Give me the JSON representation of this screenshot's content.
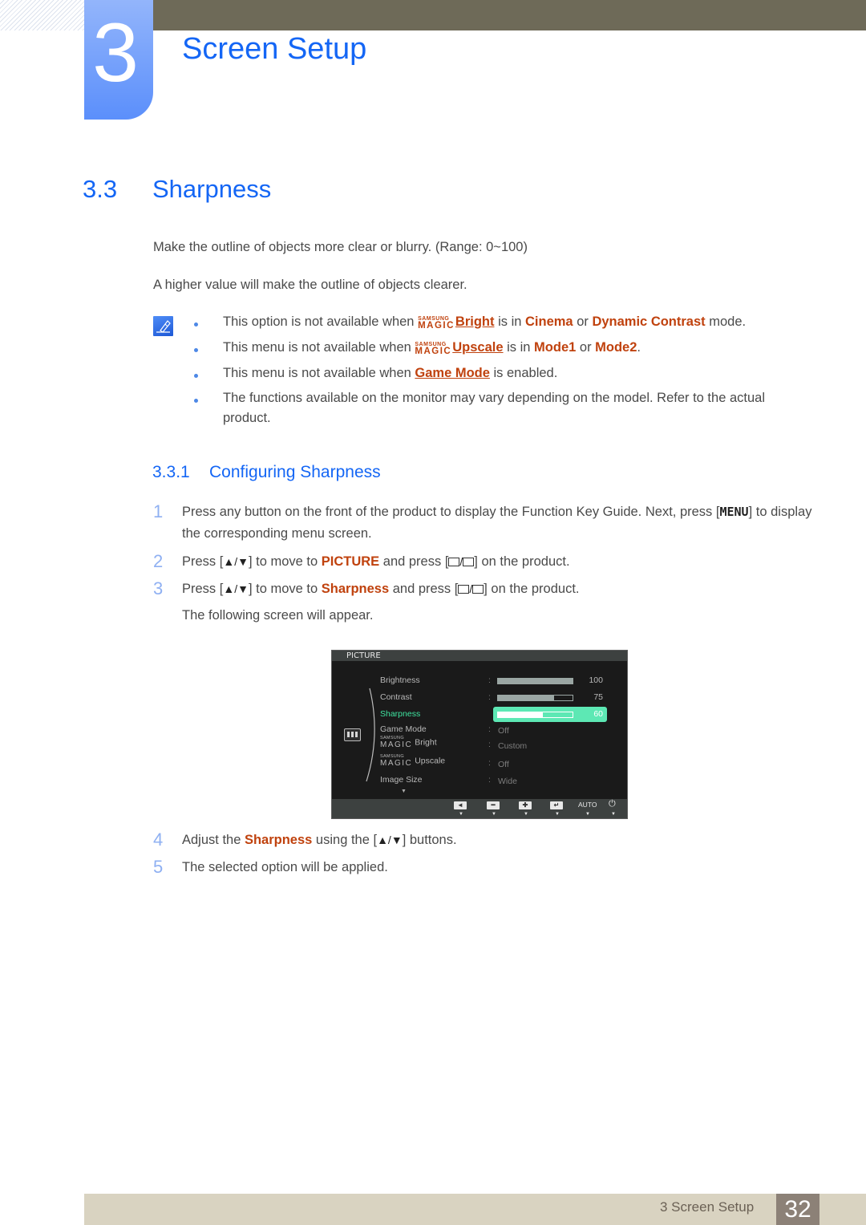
{
  "chapter": {
    "number": "3",
    "title": "Screen Setup"
  },
  "section": {
    "number": "3.3",
    "title": "Sharpness",
    "paragraphs": [
      "Make the outline of objects more clear or blurry. (Range: 0~100)",
      "A higher value will make the outline of objects clearer."
    ]
  },
  "notes": {
    "icon": "note-pencil-icon",
    "items": [
      {
        "pre": "This option is not available when ",
        "magic_small": "SAMSUNG",
        "magic_big": "MAGIC",
        "link": "Bright",
        "mid1": " is in ",
        "hl1": "Cinema",
        "mid2": " or ",
        "hl2": "Dynamic Contrast",
        "post": " mode."
      },
      {
        "pre": "This menu is not available when ",
        "magic_small": "SAMSUNG",
        "magic_big": "MAGIC",
        "link": "Upscale",
        "mid1": " is in ",
        "hl1": "Mode1",
        "mid2": " or ",
        "hl2": "Mode2",
        "post": "."
      },
      {
        "pre": "This menu is not available when ",
        "link": "Game Mode",
        "post": " is enabled."
      },
      {
        "text": "The functions available on the monitor may vary depending on the model. Refer to the actual product."
      }
    ]
  },
  "subsection": {
    "number": "3.3.1",
    "title": "Configuring Sharpness",
    "steps": [
      {
        "num": "1",
        "pre": "Press any button on the front of the product to display the Function Key Guide. Next, press [",
        "key": "MENU",
        "post": "] to display the corresponding menu screen."
      },
      {
        "num": "2",
        "pre": "Press [",
        "arrows": "▲/▼",
        "mid": "] to move to ",
        "hl": "PICTURE",
        "mid2": " and press [",
        "post": "] on the product."
      },
      {
        "num": "3",
        "pre": "Press [",
        "arrows": "▲/▼",
        "mid": "] to move to ",
        "hl": "Sharpness",
        "mid2": " and press [",
        "post": "] on the product.",
        "extra": "The following screen will appear."
      },
      {
        "num": "4",
        "pre": "Adjust the ",
        "hl": "Sharpness",
        "mid": " using the [",
        "arrows": "▲/▼",
        "post": "] buttons."
      },
      {
        "num": "5",
        "text": "The selected option will be applied."
      }
    ]
  },
  "osd": {
    "title": "PICTURE",
    "category_icon": "picture-category-icon",
    "rows": [
      {
        "label": "Brightness",
        "type": "slider",
        "value": 100,
        "value_text": "100"
      },
      {
        "label": "Contrast",
        "type": "slider",
        "value": 75,
        "value_text": "75"
      },
      {
        "label": "Sharpness",
        "type": "slider",
        "value": 60,
        "value_text": "60",
        "active": true
      },
      {
        "label": "Game Mode",
        "type": "text",
        "value_text": "Off"
      },
      {
        "label": "Bright",
        "magic_small": "SAMSUNG",
        "magic_big": "MAGIC",
        "type": "text",
        "value_text": "Custom"
      },
      {
        "label": "Upscale",
        "magic_small": "SAMSUNG",
        "magic_big": "MAGIC",
        "type": "text",
        "value_text": "Off"
      },
      {
        "label": "Image Size",
        "type": "text",
        "value_text": "Wide"
      }
    ],
    "more_indicator": "▼",
    "footer_buttons": [
      {
        "icon": "left-arrow-icon",
        "glyph": "◄"
      },
      {
        "icon": "minus-icon",
        "glyph": "━"
      },
      {
        "icon": "plus-icon",
        "glyph": "✚"
      },
      {
        "icon": "enter-icon",
        "glyph": "↵"
      },
      {
        "label": "AUTO"
      },
      {
        "icon": "power-icon",
        "glyph": "⏻"
      }
    ],
    "colors": {
      "active_text": "#3fe4a0",
      "highlight": "#5de8b4",
      "background": "#1a1a1a"
    }
  },
  "footer": {
    "chapter_label": "3 Screen Setup",
    "page_number": "32"
  },
  "colors": {
    "heading_blue": "#1466f5",
    "highlight_orange": "#c0420e",
    "step_number": "#8fb0f2",
    "top_bar": "#6e6a58",
    "footer_bar": "#d9d3c1",
    "footer_page": "#8c8177"
  }
}
